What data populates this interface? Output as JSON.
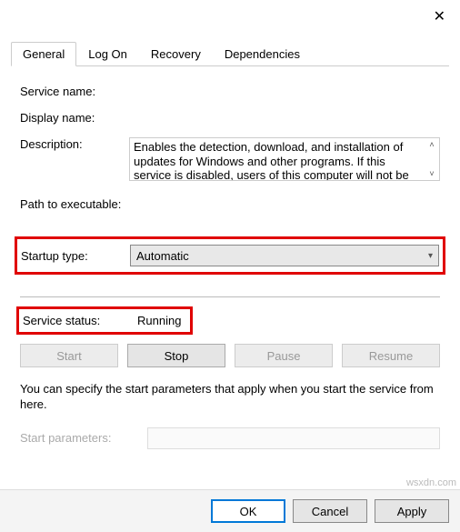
{
  "titlebar": {
    "close_icon": "✕"
  },
  "tabs": [
    {
      "label": "General",
      "active": true
    },
    {
      "label": "Log On",
      "active": false
    },
    {
      "label": "Recovery",
      "active": false
    },
    {
      "label": "Dependencies",
      "active": false
    }
  ],
  "fields": {
    "service_name_label": "Service name:",
    "service_name_value": "",
    "display_name_label": "Display name:",
    "display_name_value": "",
    "description_label": "Description:",
    "description_value": "Enables the detection, download, and installation of updates for Windows and other programs. If this service is disabled, users of this computer will not be",
    "path_label": "Path to executable:",
    "path_value": "",
    "startup_type_label": "Startup type:",
    "startup_type_value": "Automatic",
    "service_status_label": "Service status:",
    "service_status_value": "Running",
    "note_text": "You can specify the start parameters that apply when you start the service from here.",
    "start_params_label": "Start parameters:",
    "start_params_value": ""
  },
  "buttons": {
    "start": "Start",
    "stop": "Stop",
    "pause": "Pause",
    "resume": "Resume"
  },
  "footer": {
    "ok": "OK",
    "cancel": "Cancel",
    "apply": "Apply"
  },
  "scroll": {
    "up": "˄",
    "down": "˅"
  },
  "watermark": "wsxdn.com"
}
